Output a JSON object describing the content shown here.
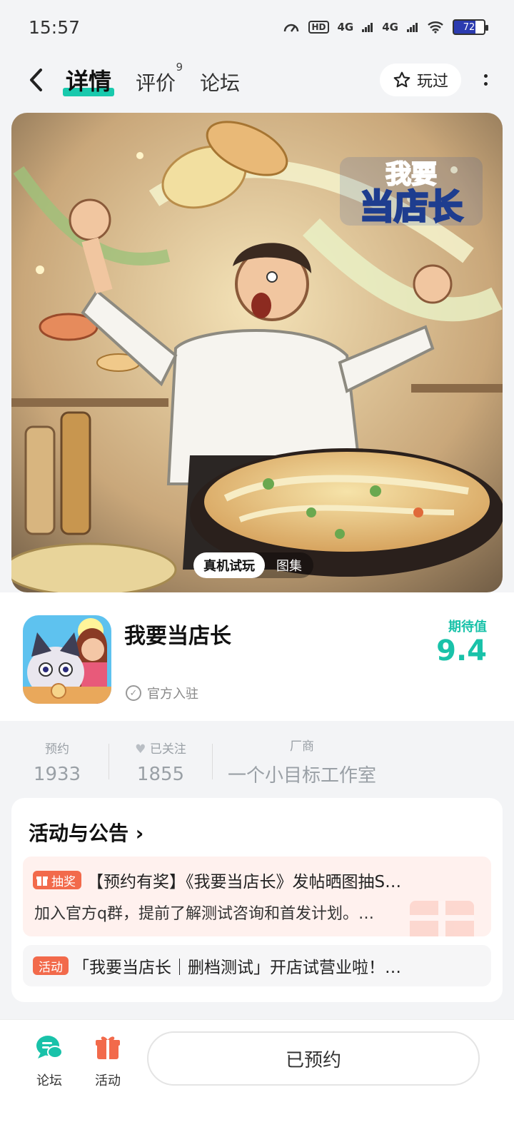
{
  "status_bar": {
    "time": "15:57",
    "network": "4G",
    "battery": "72"
  },
  "nav": {
    "back_icon": "chevron-left-icon",
    "tabs": [
      {
        "label": "详情",
        "badge": ""
      },
      {
        "label": "评价",
        "badge": "9"
      },
      {
        "label": "论坛",
        "badge": ""
      }
    ],
    "played_label": "玩过",
    "more_icon": "more-vertical-icon"
  },
  "hero": {
    "logo_line1": "我要",
    "logo_line2": "当店长",
    "pills": [
      "真机试玩",
      "图集"
    ]
  },
  "app": {
    "name": "我要当店长",
    "official_label": "官方入驻",
    "expect_label": "期待值",
    "expect_value": "9.4"
  },
  "stats": [
    {
      "label": "预约",
      "value": "1933"
    },
    {
      "label": "已关注",
      "value": "1855"
    },
    {
      "label": "厂商",
      "value": "一个小目标工作室"
    }
  ],
  "announcements": {
    "title": "活动与公告",
    "items": [
      {
        "badge": "抽奖",
        "title": "【预约有奖】《我要当店长》发帖晒图抽S…",
        "desc": "加入官方q群，提前了解测试咨询和首发计划。…"
      },
      {
        "badge": "活动",
        "title": "「我要当店长｜删档测试」开店试营业啦！…"
      }
    ]
  },
  "bottom_bar": {
    "forum_label": "论坛",
    "activity_label": "活动",
    "reserve_label": "已预约"
  },
  "colors": {
    "accent": "#19c9ad",
    "orange": "#f26a4b"
  }
}
